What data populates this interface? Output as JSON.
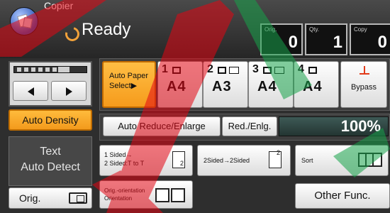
{
  "header": {
    "app_name": "Copier",
    "status": "Ready",
    "counters": [
      {
        "label": "Orig.",
        "value": "0"
      },
      {
        "label": "Qty.",
        "value": "1"
      },
      {
        "label": "Copy",
        "value": "0"
      }
    ]
  },
  "density": {
    "auto_density_label": "Auto Density",
    "level": 0.6
  },
  "original_type": {
    "line1": "Text",
    "line2": "Auto Detect"
  },
  "orig_button": {
    "label": "Orig."
  },
  "paper": {
    "auto_select_line1": "Auto Paper",
    "auto_select_line2": "Select▶",
    "trays": [
      {
        "number": "1",
        "size": "A4"
      },
      {
        "number": "2",
        "size": "A3"
      },
      {
        "number": "3",
        "size": "A4"
      },
      {
        "number": "4",
        "size": "A4"
      }
    ],
    "bypass_label": "Bypass"
  },
  "reduce": {
    "auto_reduce_label": "Auto Reduce/Enlarge",
    "red_enlg_label": "Red./Enlg.",
    "ratio": "100%"
  },
  "features": {
    "duplex_line1": "1 Sided→",
    "duplex_line2": "2 Sided:T to T",
    "combine_label": "2Sided→2Sided",
    "sort_label": "Sort",
    "orientation_line1": "Orig.-orientation",
    "orientation_line2": "Orientation",
    "other_func_label": "Other Func."
  },
  "icons": {
    "app": "copier-icon",
    "bypass": "bypass-tray-icon"
  },
  "colors": {
    "selected": "#f59b1c",
    "watermark_red": "#e30613",
    "watermark_green": "#17a34a"
  }
}
